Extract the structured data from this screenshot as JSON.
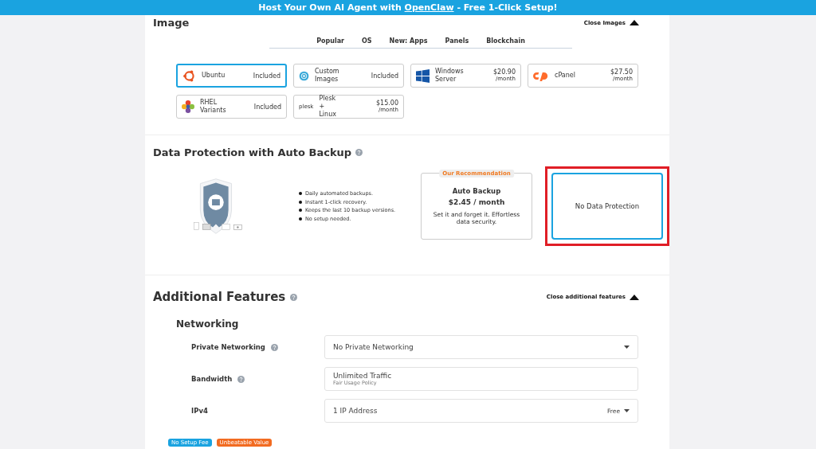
{
  "banner": {
    "before": "Host Your Own AI Agent with ",
    "link": "OpenClaw",
    "after": " - Free 1-Click Setup!"
  },
  "image_section": {
    "title": "Image",
    "toggle": "Close Images",
    "tabs": [
      {
        "label": "Popular",
        "selected": false
      },
      {
        "label": "OS",
        "selected": false
      },
      {
        "label": "New: Apps",
        "selected": false
      },
      {
        "label": "Panels",
        "selected": false
      },
      {
        "label": "Blockchain",
        "selected": false
      }
    ],
    "tiles": [
      {
        "kind": "ubuntu",
        "name": "Ubuntu",
        "price": "Included",
        "selected": true
      },
      {
        "kind": "custom",
        "name": "Custom Images",
        "price": "Included",
        "selected": false
      },
      {
        "kind": "windows",
        "name": "Windows Server",
        "price": "$20.90",
        "period": "/month",
        "selected": false
      },
      {
        "kind": "cpanel",
        "name": "cPanel",
        "price": "$27.50",
        "period": "/month",
        "selected": false
      },
      {
        "kind": "rhel",
        "name": "RHEL Variants",
        "price": "Included",
        "selected": false
      },
      {
        "kind": "plesk",
        "logo_text": "plesk",
        "name": "Plesk + Linux",
        "price": "$15.00",
        "period": "/month",
        "selected": false
      }
    ]
  },
  "data_protection": {
    "title": "Data Protection with Auto Backup",
    "bullets": [
      "Daily automated backups.",
      "Instant 1-click recovery.",
      "Keeps the last 10 backup versions.",
      "No setup needed."
    ],
    "options": [
      {
        "badge": "Our Recommendation",
        "name": "Auto Backup",
        "price": "$2.45 / month",
        "note": "Set it and forget it. Effortless data security.",
        "selected": false,
        "highlighted": false
      },
      {
        "name": "No Data Protection",
        "selected": true,
        "highlighted": true
      }
    ]
  },
  "additional": {
    "title": "Additional Features",
    "toggle": "Close additional features",
    "group": "Networking",
    "rows": [
      {
        "label": "Private Networking",
        "help": true,
        "kind": "dropdown",
        "value": "No Private Networking"
      },
      {
        "label": "Bandwidth",
        "help": true,
        "kind": "static",
        "value": "Unlimited Traffic",
        "sub": "Fair Usage Policy"
      },
      {
        "label": "IPv4",
        "help": false,
        "kind": "dropdown",
        "value": "1 IP Address",
        "price": "Free"
      }
    ]
  },
  "badges": [
    {
      "text": "No Setup Fee",
      "color": "#1aa3e0"
    },
    {
      "text": "Unbeatable Value",
      "color": "#f26b21"
    }
  ]
}
